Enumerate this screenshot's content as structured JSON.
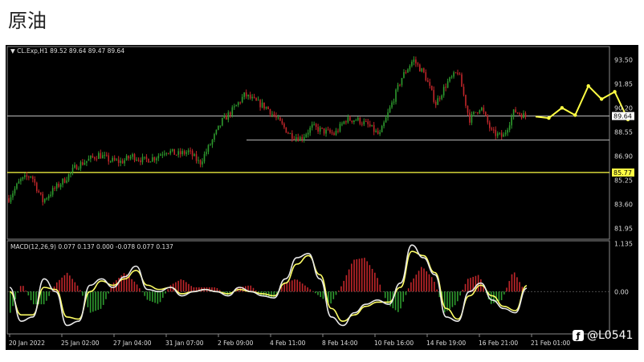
{
  "page": {
    "title": "原油"
  },
  "chart_data": {
    "type": "candlestick",
    "instrument_info": "CL.Exp,H1  89.52 89.64 89.47 89.64",
    "x_tick_labels": [
      "20 Jan 2022",
      "25 Jan 02:00",
      "27 Jan 04:00",
      "31 Jan 07:00",
      "2 Feb 09:00",
      "4 Feb 11:00",
      "8 Feb 14:00",
      "10 Feb 16:00",
      "14 Feb 19:00",
      "16 Feb 21:00",
      "21 Feb 01:00"
    ],
    "price_axis": {
      "ticks": [
        93.5,
        91.85,
        90.2,
        88.55,
        86.9,
        85.25,
        83.6,
        81.95
      ],
      "tick_labels": [
        "93.50",
        "91.85",
        "90.20",
        "88.55",
        "86.90",
        "85.25",
        "83.60",
        "81.95"
      ],
      "range": [
        81.2,
        94.4
      ]
    },
    "current_price": {
      "value": 89.64,
      "label": "89.64"
    },
    "support_line": {
      "value": 85.77,
      "label": "85.77"
    },
    "resistance_line": {
      "value": 88.0
    },
    "price_path": [
      84,
      85.2,
      85.6,
      83.8,
      84.6,
      85.3,
      86.2,
      86.6,
      87.0,
      86.6,
      86.5,
      86.9,
      86.6,
      86.8,
      87.3,
      87.0,
      87.2,
      86.4,
      87.8,
      89.3,
      90.1,
      91.1,
      90.6,
      90.2,
      89.3,
      88.4,
      88.1,
      88.9,
      88.6,
      88.4,
      89.4,
      89.4,
      89.0,
      88.3,
      90.3,
      92.3,
      93.5,
      92.5,
      90.5,
      91.9,
      92.7,
      89.4,
      90.3,
      88.5,
      88.2,
      90.0,
      89.6
    ],
    "forecast_path": [
      89.6,
      89.5,
      90.2,
      89.7,
      91.7,
      90.8,
      91.3,
      89.4
    ],
    "macd": {
      "label": "MACD(12,26,9) 0.077 0.137 0.000 -0.078 0.077 0.137",
      "ticks": [
        1.135,
        0.0
      ],
      "tick_labels": [
        "1.135",
        "0.00"
      ],
      "range": [
        -1.0,
        1.2
      ],
      "histogram": [
        -0.5,
        0.2,
        -0.3,
        -0.3,
        0.2,
        0.45,
        0.1,
        -0.5,
        -0.4,
        0.2,
        0.45,
        0.2,
        -0.2,
        -0.3,
        0.15,
        0.3,
        0.1,
        0.1,
        0.1,
        -0.1,
        0.1,
        0.15,
        -0.1,
        -0.15,
        0.2,
        0.3,
        0.1,
        -0.1,
        -0.3,
        0.15,
        0.75,
        0.8,
        0.4,
        -0.3,
        -0.5,
        0.2,
        0.6,
        0.3,
        -0.5,
        -0.3,
        0.3,
        0.4,
        -0.3,
        -0.2,
        0.5,
        0.0
      ],
      "macd_line": [
        0.1,
        -0.7,
        -0.6,
        0.3,
        0.0,
        -0.8,
        -0.7,
        0.15,
        0.3,
        0.1,
        0.35,
        0.6,
        0.05,
        0.0,
        0.1,
        -0.1,
        0.0,
        0.05,
        0.0,
        -0.1,
        0.1,
        0.0,
        -0.1,
        -0.15,
        0.3,
        0.8,
        0.9,
        0.3,
        -0.6,
        -0.8,
        -0.5,
        -0.3,
        -0.2,
        -0.3,
        0.2,
        1.1,
        0.8,
        0.4,
        -0.6,
        -0.7,
        0.0,
        0.2,
        -0.2,
        -0.4,
        -0.5,
        0.08
      ],
      "signal_line": [
        0.0,
        -0.55,
        -0.55,
        0.1,
        0.05,
        -0.6,
        -0.65,
        0.0,
        0.25,
        0.15,
        0.3,
        0.5,
        0.15,
        0.05,
        0.1,
        -0.05,
        0.0,
        0.05,
        0.0,
        -0.05,
        0.05,
        0.0,
        -0.05,
        -0.1,
        0.2,
        0.65,
        0.85,
        0.4,
        -0.4,
        -0.7,
        -0.55,
        -0.35,
        -0.25,
        -0.25,
        0.1,
        0.95,
        0.85,
        0.45,
        -0.4,
        -0.65,
        -0.1,
        0.15,
        -0.1,
        -0.35,
        -0.45,
        0.14
      ]
    }
  },
  "watermark": {
    "text": "@L0541",
    "icon": "social-logo-icon"
  },
  "colors": {
    "background": "#000000",
    "bull": "#2e9b2e",
    "bear": "#c0262a",
    "forecast": "#ffff44",
    "macd": "#e8e8e8",
    "signal": "#ffff66",
    "support": "#ffff44",
    "grid": "#8a8a8a"
  }
}
